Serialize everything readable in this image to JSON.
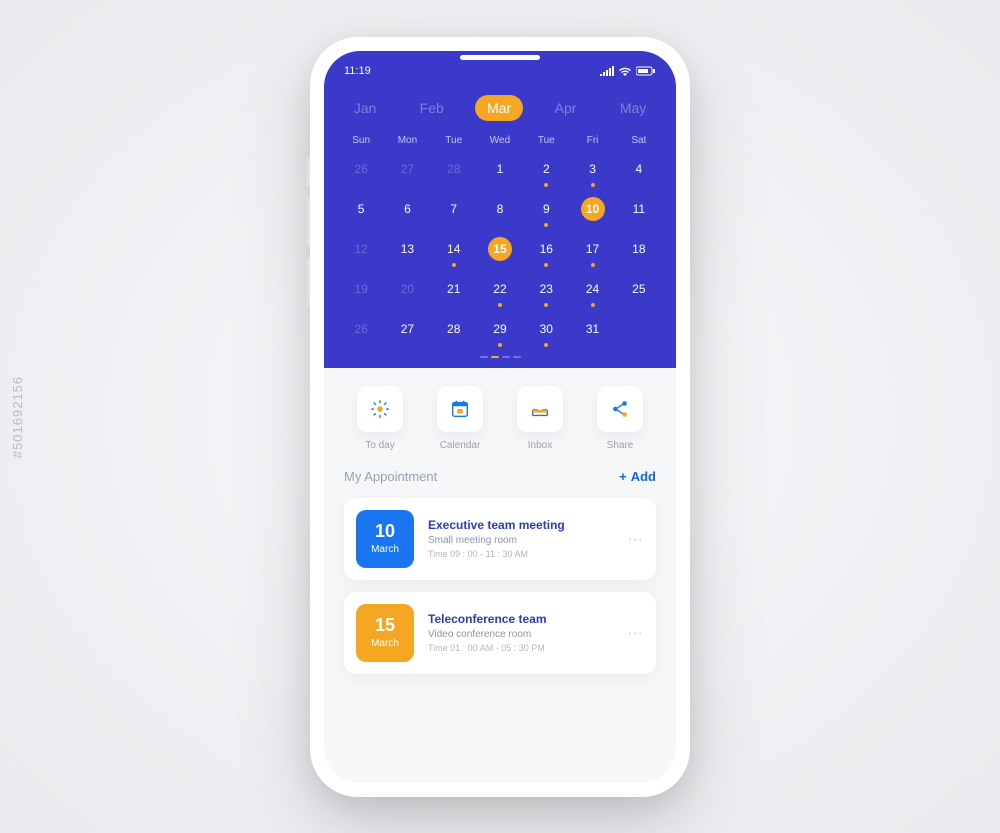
{
  "status": {
    "time": "11:19"
  },
  "months": [
    {
      "label": "Jan",
      "selected": false
    },
    {
      "label": "Feb",
      "selected": false
    },
    {
      "label": "Mar",
      "selected": true
    },
    {
      "label": "Apr",
      "selected": false
    },
    {
      "label": "May",
      "selected": false
    }
  ],
  "weekdays": [
    "Sun",
    "Mon",
    "Tue",
    "Wed",
    "Tue",
    "Fri",
    "Sat"
  ],
  "days": [
    {
      "n": 26,
      "faded": true,
      "hl": false,
      "dot": false
    },
    {
      "n": 27,
      "faded": true,
      "hl": false,
      "dot": false
    },
    {
      "n": 28,
      "faded": true,
      "hl": false,
      "dot": false
    },
    {
      "n": 1,
      "faded": false,
      "hl": false,
      "dot": false
    },
    {
      "n": 2,
      "faded": false,
      "hl": false,
      "dot": true
    },
    {
      "n": 3,
      "faded": false,
      "hl": false,
      "dot": true
    },
    {
      "n": 4,
      "faded": false,
      "hl": false,
      "dot": false
    },
    {
      "n": 5,
      "faded": false,
      "hl": false,
      "dot": false
    },
    {
      "n": 6,
      "faded": false,
      "hl": false,
      "dot": false
    },
    {
      "n": 7,
      "faded": false,
      "hl": false,
      "dot": false
    },
    {
      "n": 8,
      "faded": false,
      "hl": false,
      "dot": false
    },
    {
      "n": 9,
      "faded": false,
      "hl": false,
      "dot": true
    },
    {
      "n": 10,
      "faded": false,
      "hl": true,
      "dot": false
    },
    {
      "n": 11,
      "faded": false,
      "hl": false,
      "dot": false
    },
    {
      "n": 12,
      "faded": true,
      "hl": false,
      "dot": false
    },
    {
      "n": 13,
      "faded": false,
      "hl": false,
      "dot": false
    },
    {
      "n": 14,
      "faded": false,
      "hl": false,
      "dot": true
    },
    {
      "n": 15,
      "faded": false,
      "hl": true,
      "dot": false
    },
    {
      "n": 16,
      "faded": false,
      "hl": false,
      "dot": true
    },
    {
      "n": 17,
      "faded": false,
      "hl": false,
      "dot": true
    },
    {
      "n": 18,
      "faded": false,
      "hl": false,
      "dot": false
    },
    {
      "n": 19,
      "faded": true,
      "hl": false,
      "dot": false
    },
    {
      "n": 20,
      "faded": true,
      "hl": false,
      "dot": false
    },
    {
      "n": 21,
      "faded": false,
      "hl": false,
      "dot": false
    },
    {
      "n": 22,
      "faded": false,
      "hl": false,
      "dot": true
    },
    {
      "n": 23,
      "faded": false,
      "hl": false,
      "dot": true
    },
    {
      "n": 24,
      "faded": false,
      "hl": false,
      "dot": true
    },
    {
      "n": 25,
      "faded": false,
      "hl": false,
      "dot": false
    },
    {
      "n": 26,
      "faded": true,
      "hl": false,
      "dot": false
    },
    {
      "n": 27,
      "faded": false,
      "hl": false,
      "dot": false
    },
    {
      "n": 28,
      "faded": false,
      "hl": false,
      "dot": false
    },
    {
      "n": 29,
      "faded": false,
      "hl": false,
      "dot": true
    },
    {
      "n": 30,
      "faded": false,
      "hl": false,
      "dot": true
    },
    {
      "n": 31,
      "faded": false,
      "hl": false,
      "dot": false
    },
    {
      "n": "",
      "faded": true,
      "hl": false,
      "dot": false
    }
  ],
  "quickActions": [
    {
      "key": "today",
      "label": "To day"
    },
    {
      "key": "calendar",
      "label": "Calendar"
    },
    {
      "key": "inbox",
      "label": "Inbox"
    },
    {
      "key": "share",
      "label": "Share"
    }
  ],
  "appointments": {
    "title": "My Appointment",
    "addLabel": "Add",
    "items": [
      {
        "day": "10",
        "month": "March",
        "color": "blue",
        "name": "Executive team meeting",
        "room": "Small meeting room",
        "time": "Time 09 : 00 - 11 : 30 AM"
      },
      {
        "day": "15",
        "month": "March",
        "color": "orange",
        "name": "Teleconference team",
        "room": "Video conference room",
        "time": "Time 01 : 00 AM - 05 : 30 PM"
      }
    ]
  },
  "watermark": "#501692156"
}
